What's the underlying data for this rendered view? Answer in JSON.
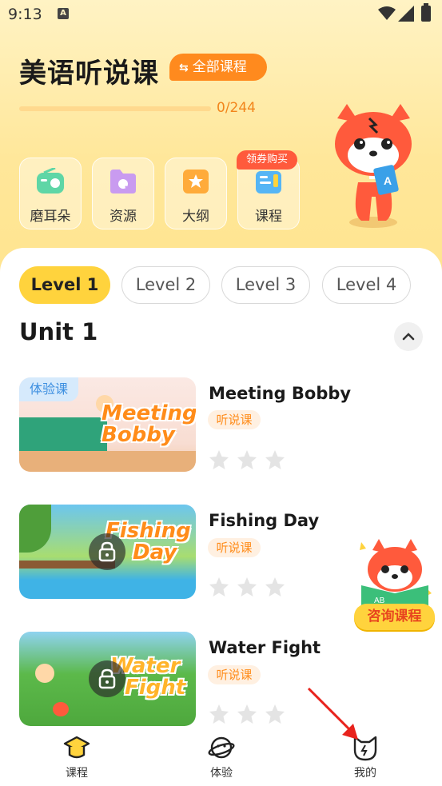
{
  "status_bar": {
    "time": "9:13",
    "notification_icon": "A"
  },
  "header": {
    "title": "美语听说课",
    "all_courses_label": "全部课程"
  },
  "progress": {
    "text": "0/244",
    "completed": 0,
    "total": 244
  },
  "features": [
    {
      "label": "磨耳朵",
      "icon": "radio-icon",
      "color": "#5fd6a6"
    },
    {
      "label": "资源",
      "icon": "folder-icon",
      "color": "#c99bf0"
    },
    {
      "label": "大纲",
      "icon": "book-star-icon",
      "color": "#ffab3a"
    },
    {
      "label": "课程",
      "icon": "course-icon",
      "color": "#55b5f5",
      "badge": "领券购买"
    }
  ],
  "levels": [
    {
      "label": "Level 1",
      "active": true
    },
    {
      "label": "Level 2",
      "active": false
    },
    {
      "label": "Level 3",
      "active": false
    },
    {
      "label": "Level 4",
      "active": false
    }
  ],
  "unit": {
    "title": "Unit 1"
  },
  "lessons": [
    {
      "title": "Meeting Bobby",
      "tag": "听说课",
      "thumb_line1": "Meeting",
      "thumb_line2": "Bobby",
      "trial_label": "体验课",
      "locked": false,
      "stars": 0
    },
    {
      "title": "Fishing Day",
      "tag": "听说课",
      "thumb_line1": "Fishing",
      "thumb_line2": "Day",
      "locked": true,
      "stars": 0
    },
    {
      "title": "Water Fight",
      "tag": "听说课",
      "thumb_line1": "Water",
      "thumb_line2": "Fight",
      "locked": true,
      "stars": 0
    }
  ],
  "consult": {
    "label": "咨询课程"
  },
  "bottom_nav": [
    {
      "label": "课程",
      "icon": "graduation-cap-icon"
    },
    {
      "label": "体验",
      "icon": "planet-icon"
    },
    {
      "label": "我的",
      "icon": "cat-head-icon"
    }
  ],
  "colors": {
    "accent_yellow": "#ffd33d",
    "accent_orange": "#ff8a1e",
    "coupon_red": "#ff5a3c"
  }
}
